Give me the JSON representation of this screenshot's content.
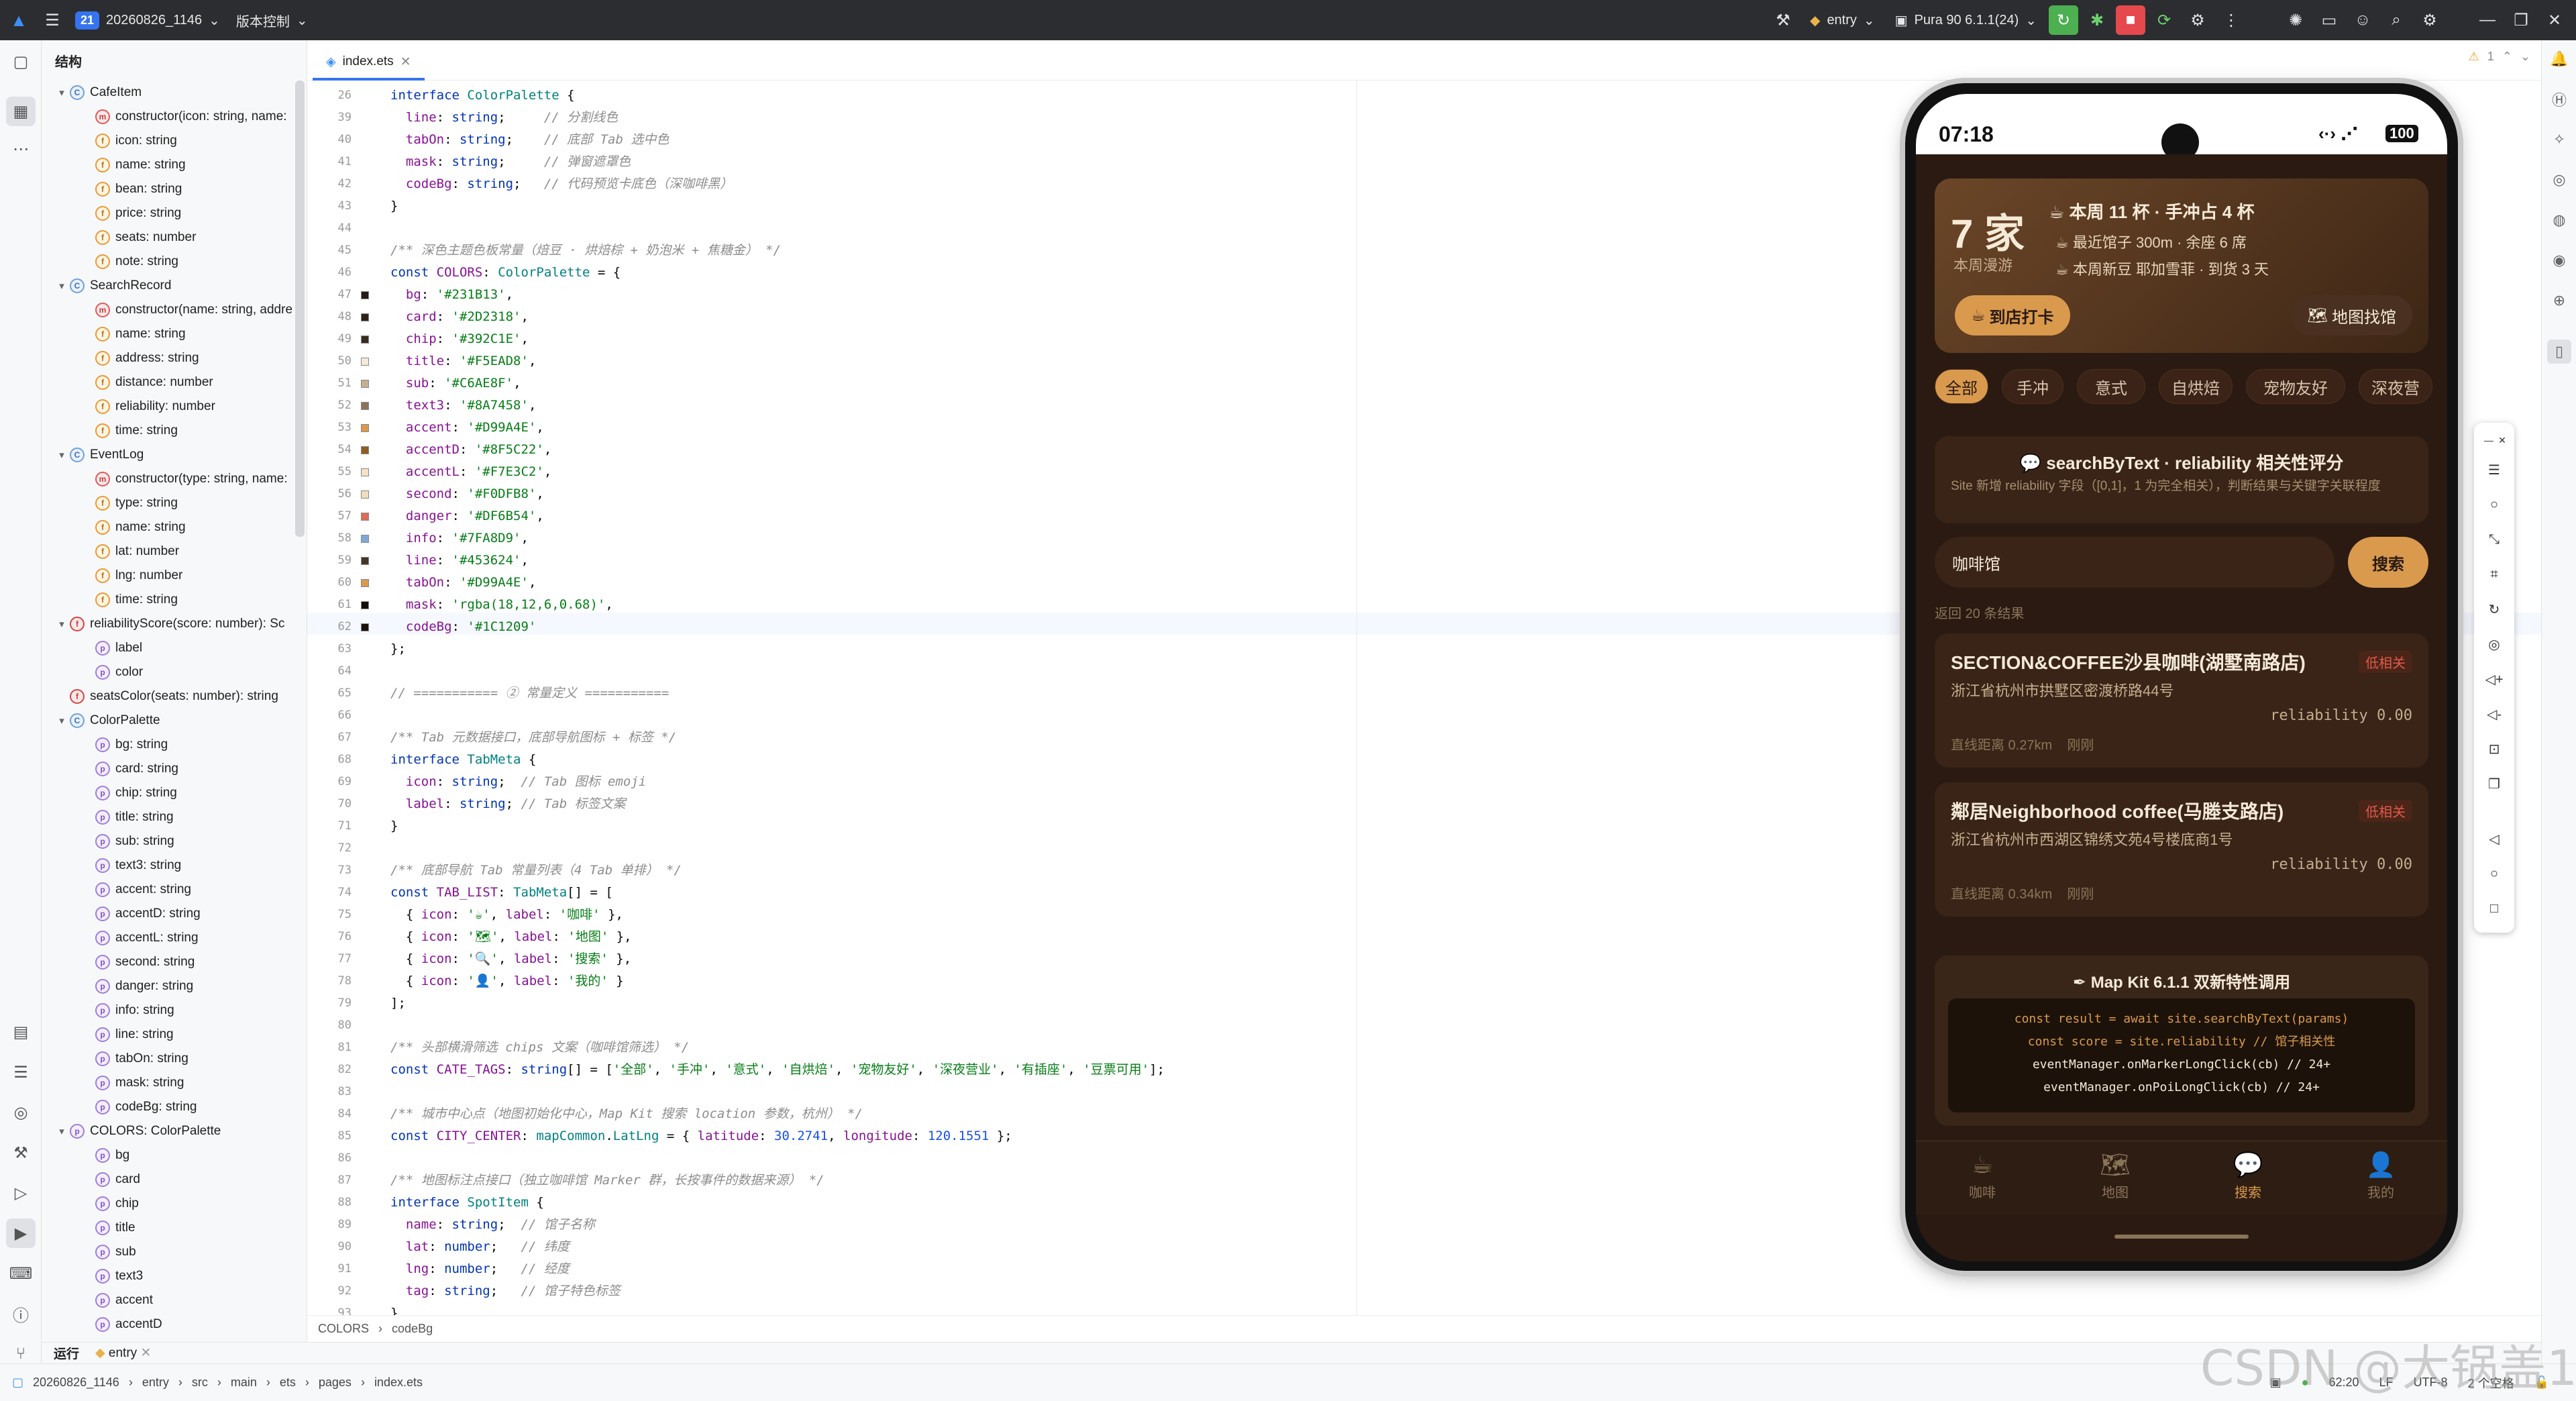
{
  "topbar": {
    "project_badge": "21",
    "project_name": "20260826_1146",
    "vcs": "版本控制",
    "module": "entry",
    "device": "Pura 90 6.1.1(24)"
  },
  "structure": {
    "title": "结构",
    "items": [
      {
        "d": 1,
        "arrow": "▾",
        "kind": "c",
        "label": "CafeItem"
      },
      {
        "d": 2,
        "kind": "m",
        "label": "constructor(icon: string, name:"
      },
      {
        "d": 2,
        "kind": "f",
        "label": "icon: string"
      },
      {
        "d": 2,
        "kind": "f",
        "label": "name: string"
      },
      {
        "d": 2,
        "kind": "f",
        "label": "bean: string"
      },
      {
        "d": 2,
        "kind": "f",
        "label": "price: string"
      },
      {
        "d": 2,
        "kind": "f",
        "label": "seats: number"
      },
      {
        "d": 2,
        "kind": "f",
        "label": "note: string"
      },
      {
        "d": 1,
        "arrow": "▾",
        "kind": "c",
        "label": "SearchRecord"
      },
      {
        "d": 2,
        "kind": "m",
        "label": "constructor(name: string, addre"
      },
      {
        "d": 2,
        "kind": "f",
        "label": "name: string"
      },
      {
        "d": 2,
        "kind": "f",
        "label": "address: string"
      },
      {
        "d": 2,
        "kind": "f",
        "label": "distance: number"
      },
      {
        "d": 2,
        "kind": "f",
        "label": "reliability: number"
      },
      {
        "d": 2,
        "kind": "f",
        "label": "time: string"
      },
      {
        "d": 1,
        "arrow": "▾",
        "kind": "c",
        "label": "EventLog"
      },
      {
        "d": 2,
        "kind": "m",
        "label": "constructor(type: string, name:"
      },
      {
        "d": 2,
        "kind": "f",
        "label": "type: string"
      },
      {
        "d": 2,
        "kind": "f",
        "label": "name: string"
      },
      {
        "d": 2,
        "kind": "f",
        "label": "lat: number"
      },
      {
        "d": 2,
        "kind": "f",
        "label": "lng: number"
      },
      {
        "d": 2,
        "kind": "f",
        "label": "time: string"
      },
      {
        "d": 1,
        "arrow": "▾",
        "kind": "e",
        "label": "reliabilityScore(score: number): Sc"
      },
      {
        "d": 2,
        "kind": "p",
        "label": "label"
      },
      {
        "d": 2,
        "kind": "p",
        "label": "color"
      },
      {
        "d": 1,
        "kind": "e",
        "label": "seatsColor(seats: number): string"
      },
      {
        "d": 1,
        "arrow": "▾",
        "kind": "c",
        "label": "ColorPalette"
      },
      {
        "d": 2,
        "kind": "p",
        "label": "bg: string"
      },
      {
        "d": 2,
        "kind": "p",
        "label": "card: string"
      },
      {
        "d": 2,
        "kind": "p",
        "label": "chip: string"
      },
      {
        "d": 2,
        "kind": "p",
        "label": "title: string"
      },
      {
        "d": 2,
        "kind": "p",
        "label": "sub: string"
      },
      {
        "d": 2,
        "kind": "p",
        "label": "text3: string"
      },
      {
        "d": 2,
        "kind": "p",
        "label": "accent: string"
      },
      {
        "d": 2,
        "kind": "p",
        "label": "accentD: string"
      },
      {
        "d": 2,
        "kind": "p",
        "label": "accentL: string"
      },
      {
        "d": 2,
        "kind": "p",
        "label": "second: string"
      },
      {
        "d": 2,
        "kind": "p",
        "label": "danger: string"
      },
      {
        "d": 2,
        "kind": "p",
        "label": "info: string"
      },
      {
        "d": 2,
        "kind": "p",
        "label": "line: string"
      },
      {
        "d": 2,
        "kind": "p",
        "label": "tabOn: string"
      },
      {
        "d": 2,
        "kind": "p",
        "label": "mask: string"
      },
      {
        "d": 2,
        "kind": "p",
        "label": "codeBg: string"
      },
      {
        "d": 1,
        "arrow": "▾",
        "kind": "p",
        "label": "COLORS: ColorPalette"
      },
      {
        "d": 2,
        "kind": "p",
        "label": "bg"
      },
      {
        "d": 2,
        "kind": "p",
        "label": "card"
      },
      {
        "d": 2,
        "kind": "p",
        "label": "chip"
      },
      {
        "d": 2,
        "kind": "p",
        "label": "title"
      },
      {
        "d": 2,
        "kind": "p",
        "label": "sub"
      },
      {
        "d": 2,
        "kind": "p",
        "label": "text3"
      },
      {
        "d": 2,
        "kind": "p",
        "label": "accent"
      },
      {
        "d": 2,
        "kind": "p",
        "label": "accentD"
      }
    ]
  },
  "editor": {
    "tab": "index.ets",
    "warnings": "1",
    "lines": [
      {
        "n": "26",
        "html": "<span class='kw'>interface</span> <span class='ty'>ColorPalette</span> {"
      },
      {
        "n": "39",
        "html": "  <span class='pr'>line</span>: <span class='kw'>string</span>;     <span class='cm'>// 分割线色</span>"
      },
      {
        "n": "40",
        "html": "  <span class='pr'>tabOn</span>: <span class='kw'>string</span>;    <span class='cm'>// 底部 Tab 选中色</span>"
      },
      {
        "n": "41",
        "html": "  <span class='pr'>mask</span>: <span class='kw'>string</span>;     <span class='cm'>// 弹窗遮罩色</span>"
      },
      {
        "n": "42",
        "html": "  <span class='pr'>codeBg</span>: <span class='kw'>string</span>;   <span class='cm'>// 代码预览卡底色（深咖啡黑）</span>"
      },
      {
        "n": "43",
        "html": "}"
      },
      {
        "n": "44",
        "html": ""
      },
      {
        "n": "45",
        "html": "<span class='cm'>/** 深色主题色板常量（焙豆 · 烘焙棕 + 奶泡米 + 焦糖金） */</span>"
      },
      {
        "n": "46",
        "html": "<span class='kw'>const</span> <span class='pr'>COLORS</span>: <span class='ty'>ColorPalette</span> = {"
      },
      {
        "n": "47",
        "sw": "#231B13",
        "html": "  <span class='pr'>bg</span>: <span class='st'>'#231B13'</span>,"
      },
      {
        "n": "48",
        "sw": "#2D2318",
        "html": "  <span class='pr'>card</span>: <span class='st'>'#2D2318'</span>,"
      },
      {
        "n": "49",
        "sw": "#392C1E",
        "html": "  <span class='pr'>chip</span>: <span class='st'>'#392C1E'</span>,"
      },
      {
        "n": "50",
        "sw": "#F5EAD8",
        "html": "  <span class='pr'>title</span>: <span class='st'>'#F5EAD8'</span>,"
      },
      {
        "n": "51",
        "sw": "#C6AE8F",
        "html": "  <span class='pr'>sub</span>: <span class='st'>'#C6AE8F'</span>,"
      },
      {
        "n": "52",
        "sw": "#8A7458",
        "html": "  <span class='pr'>text3</span>: <span class='st'>'#8A7458'</span>,"
      },
      {
        "n": "53",
        "sw": "#D99A4E",
        "html": "  <span class='pr'>accent</span>: <span class='st'>'#D99A4E'</span>,"
      },
      {
        "n": "54",
        "sw": "#8F5C22",
        "html": "  <span class='pr'>accentD</span>: <span class='st'>'#8F5C22'</span>,"
      },
      {
        "n": "55",
        "sw": "#F7E3C2",
        "html": "  <span class='pr'>accentL</span>: <span class='st'>'#F7E3C2'</span>,"
      },
      {
        "n": "56",
        "sw": "#F0DFB8",
        "html": "  <span class='pr'>second</span>: <span class='st'>'#F0DFB8'</span>,"
      },
      {
        "n": "57",
        "sw": "#DF6B54",
        "html": "  <span class='pr'>danger</span>: <span class='st'>'#DF6B54'</span>,"
      },
      {
        "n": "58",
        "sw": "#7FA8D9",
        "html": "  <span class='pr'>info</span>: <span class='st'>'#7FA8D9'</span>,"
      },
      {
        "n": "59",
        "sw": "#453624",
        "html": "  <span class='pr'>line</span>: <span class='st'>'#453624'</span>,"
      },
      {
        "n": "60",
        "sw": "#D99A4E",
        "html": "  <span class='pr'>tabOn</span>: <span class='st'>'#D99A4E'</span>,"
      },
      {
        "n": "61",
        "sw": "#120C06",
        "html": "  <span class='pr'>mask</span>: <span class='st'>'rgba(18,12,6,0.68)'</span>,"
      },
      {
        "n": "62",
        "sw": "#1C1209",
        "html": "  <span class='pr'>codeBg</span>: <span class='st'>'#1C1209'</span>"
      },
      {
        "n": "63",
        "html": "};"
      },
      {
        "n": "64",
        "html": ""
      },
      {
        "n": "65",
        "html": "<span class='cm'>// =========== ② 常量定义 ===========</span>"
      },
      {
        "n": "66",
        "html": ""
      },
      {
        "n": "67",
        "html": "<span class='cm'>/** Tab 元数据接口，底部导航图标 + 标签 */</span>"
      },
      {
        "n": "68",
        "html": "<span class='kw'>interface</span> <span class='ty'>TabMeta</span> {"
      },
      {
        "n": "69",
        "html": "  <span class='pr'>icon</span>: <span class='kw'>string</span>;  <span class='cm'>// Tab 图标 emoji</span>"
      },
      {
        "n": "70",
        "html": "  <span class='pr'>label</span>: <span class='kw'>string</span>; <span class='cm'>// Tab 标签文案</span>"
      },
      {
        "n": "71",
        "html": "}"
      },
      {
        "n": "72",
        "html": ""
      },
      {
        "n": "73",
        "html": "<span class='cm'>/** 底部导航 Tab 常量列表（4 Tab 单排） */</span>"
      },
      {
        "n": "74",
        "html": "<span class='kw'>const</span> <span class='pr'>TAB_LIST</span>: <span class='ty'>TabMeta</span>[] = ["
      },
      {
        "n": "75",
        "html": "  { <span class='pr'>icon</span>: <span class='st'>'☕'</span>, <span class='pr'>label</span>: <span class='st'>'咖啡'</span> },"
      },
      {
        "n": "76",
        "html": "  { <span class='pr'>icon</span>: <span class='st'>'🗺'</span>, <span class='pr'>label</span>: <span class='st'>'地图'</span> },"
      },
      {
        "n": "77",
        "html": "  { <span class='pr'>icon</span>: <span class='st'>'🔍'</span>, <span class='pr'>label</span>: <span class='st'>'搜索'</span> },"
      },
      {
        "n": "78",
        "html": "  { <span class='pr'>icon</span>: <span class='st'>'👤'</span>, <span class='pr'>label</span>: <span class='st'>'我的'</span> }"
      },
      {
        "n": "79",
        "html": "];"
      },
      {
        "n": "80",
        "html": ""
      },
      {
        "n": "81",
        "html": "<span class='cm'>/** 头部横滑筛选 chips 文案（咖啡馆筛选） */</span>"
      },
      {
        "n": "82",
        "html": "<span class='kw'>const</span> <span class='pr'>CATE_TAGS</span>: <span class='kw'>string</span>[] = [<span class='st'>'全部'</span>, <span class='st'>'手冲'</span>, <span class='st'>'意式'</span>, <span class='st'>'自烘焙'</span>, <span class='st'>'宠物友好'</span>, <span class='st'>'深夜营业'</span>, <span class='st'>'有插座'</span>, <span class='st'>'豆票可用'</span>];"
      },
      {
        "n": "83",
        "html": ""
      },
      {
        "n": "84",
        "html": "<span class='cm'>/** 城市中心点（地图初始化中心，Map Kit 搜索 location 参数，杭州） */</span>"
      },
      {
        "n": "85",
        "html": "<span class='kw'>const</span> <span class='pr'>CITY_CENTER</span>: <span class='ty'>mapCommon</span>.<span class='ty'>LatLng</span> = { <span class='pr'>latitude</span>: <span class='nm'>30.2741</span>, <span class='pr'>longitude</span>: <span class='nm'>120.1551</span> };"
      },
      {
        "n": "86",
        "html": ""
      },
      {
        "n": "87",
        "html": "<span class='cm'>/** 地图标注点接口（独立咖啡馆 Marker 群，长按事件的数据来源） */</span>"
      },
      {
        "n": "88",
        "html": "<span class='kw'>interface</span> <span class='ty'>SpotItem</span> {"
      },
      {
        "n": "89",
        "html": "  <span class='pr'>name</span>: <span class='kw'>string</span>;  <span class='cm'>// 馆子名称</span>"
      },
      {
        "n": "90",
        "html": "  <span class='pr'>lat</span>: <span class='kw'>number</span>;   <span class='cm'>// 纬度</span>"
      },
      {
        "n": "91",
        "html": "  <span class='pr'>lng</span>: <span class='kw'>number</span>;   <span class='cm'>// 经度</span>"
      },
      {
        "n": "92",
        "html": "  <span class='pr'>tag</span>: <span class='kw'>string</span>;   <span class='cm'>// 馆子特色标签</span>"
      },
      {
        "n": "93",
        "html": "}"
      }
    ]
  },
  "crumb": [
    "COLORS",
    "codeBg"
  ],
  "run_bar": {
    "label": "运行",
    "config": "entry"
  },
  "status": {
    "path": [
      "20260826_1146",
      "entry",
      "src",
      "main",
      "ets",
      "pages",
      "index.ets"
    ],
    "pos": "62:20",
    "eol": "LF",
    "enc": "UTF-8",
    "indent": "2 个空格"
  },
  "phone": {
    "time": "07:18",
    "battery": "100",
    "hero": {
      "count": "7 家",
      "sub": "本周漫游",
      "line1": "本周 11 杯 · 手冲占 4 杯",
      "line2": "最近馆子 300m · 余座 6 席",
      "line3": "本周新豆 耶加雪菲 · 到货 3 天",
      "checkin": "到店打卡",
      "map": "地图找馆"
    },
    "chips": [
      "全部",
      "手冲",
      "意式",
      "自烘焙",
      "宠物友好",
      "深夜营"
    ],
    "search_card": {
      "title": "searchByText · reliability 相关性评分",
      "desc": "Site 新增 reliability 字段（[0,1]，1 为完全相关），判断结果与关键字关联程度"
    },
    "search_input": "咖啡馆",
    "search_btn": "搜索",
    "result_count": "返回 20 条结果",
    "results": [
      {
        "name": "SECTION&COFFEE沙县咖啡(湖墅南路店)",
        "tag": "低相关",
        "addr": "浙江省杭州市拱墅区密渡桥路44号",
        "rel": "reliability 0.00",
        "dist": "直线距离 0.27km    刚刚"
      },
      {
        "name": "鄰居Neighborhood coffee(马塍支路店)",
        "tag": "低相关",
        "addr": "浙江省杭州市西湖区锦绣文苑4号楼底商1号",
        "rel": "reliability 0.00",
        "dist": "直线距离 0.34km    刚刚"
      }
    ],
    "code_card": {
      "title": "Map Kit 6.1.1 双新特性调用",
      "lines": [
        "const result = await site.searchByText(params)",
        "const score = site.reliability  // 馆子相关性",
        "eventManager.onMarkerLongClick(cb)  // 24+",
        "eventManager.onPoiLongClick(cb)     // 24+"
      ]
    },
    "tabs": [
      {
        "icon": "☕",
        "label": "咖啡"
      },
      {
        "icon": "🗺",
        "label": "地图"
      },
      {
        "icon": "💬",
        "label": "搜索"
      },
      {
        "icon": "👤",
        "label": "我的"
      }
    ]
  },
  "watermark": "CSDN @大锅盖1"
}
